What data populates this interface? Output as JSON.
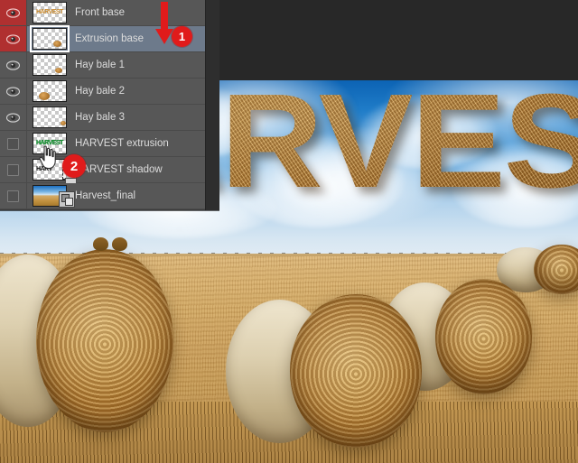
{
  "app": {
    "title": "Photoshop Layers Panel over Harvest composite",
    "canvas_background": "#282828"
  },
  "layers_panel": {
    "name": "Layers",
    "rows": [
      {
        "name": "Front base",
        "visible": true,
        "visibility_icon": "eye-icon",
        "visibility_highlight": "#b03030",
        "selected": false,
        "thumbnail": {
          "type": "transparent-word",
          "word": "HARVEST",
          "word_color": "#c98a2e"
        }
      },
      {
        "name": "Extrusion base",
        "visible": true,
        "visibility_icon": "eye-icon",
        "visibility_highlight": "#b03030",
        "selected": true,
        "thumbnail": {
          "type": "transparent-bale",
          "word": "",
          "word_color": ""
        }
      },
      {
        "name": "Hay bale 1",
        "visible": true,
        "visibility_icon": "eye-icon",
        "visibility_highlight": "",
        "selected": false,
        "thumbnail": {
          "type": "transparent-bale",
          "word": "",
          "word_color": ""
        }
      },
      {
        "name": "Hay bale 2",
        "visible": true,
        "visibility_icon": "eye-icon",
        "visibility_highlight": "",
        "selected": false,
        "thumbnail": {
          "type": "transparent-bale",
          "word": "",
          "word_color": ""
        }
      },
      {
        "name": "Hay bale 3",
        "visible": true,
        "visibility_icon": "eye-icon",
        "visibility_highlight": "",
        "selected": false,
        "thumbnail": {
          "type": "transparent-bale",
          "word": "",
          "word_color": ""
        }
      },
      {
        "name": "HARVEST extrusion",
        "visible": false,
        "visibility_icon": "empty-checkbox",
        "visibility_highlight": "",
        "selected": false,
        "thumbnail": {
          "type": "transparent-word",
          "word": "HARVEST",
          "word_color": "#1faa3c"
        }
      },
      {
        "name": "HARVEST shadow",
        "visible": false,
        "visibility_icon": "empty-checkbox",
        "visibility_highlight": "",
        "selected": false,
        "thumbnail": {
          "type": "transparent-word-mask",
          "word": "HARV",
          "word_color": "#111111"
        }
      },
      {
        "name": "Harvest_final",
        "visible": false,
        "visibility_icon": "empty-checkbox",
        "visibility_highlight": "",
        "selected": false,
        "thumbnail": {
          "type": "photo-smartobject",
          "word": "",
          "word_color": ""
        }
      }
    ]
  },
  "annotations": {
    "badge_1": "1",
    "badge_2": "2",
    "arrow_color": "#e01b1b",
    "badge_color": "#e01b1b",
    "arrow_name": "down-arrow-pointing-to-extrusion-base",
    "cursor_name": "hand-cursor-over-harvest-shadow-thumbnail"
  },
  "artwork": {
    "headline_text": "HARVEST",
    "headline_style": "hay-straw-texture-3d",
    "scene": "wheat field with round hay bales under blue cloudy sky",
    "sky_color": "#1f7cc8",
    "field_color": "#c79a56",
    "hay_color": "#b9853f"
  }
}
